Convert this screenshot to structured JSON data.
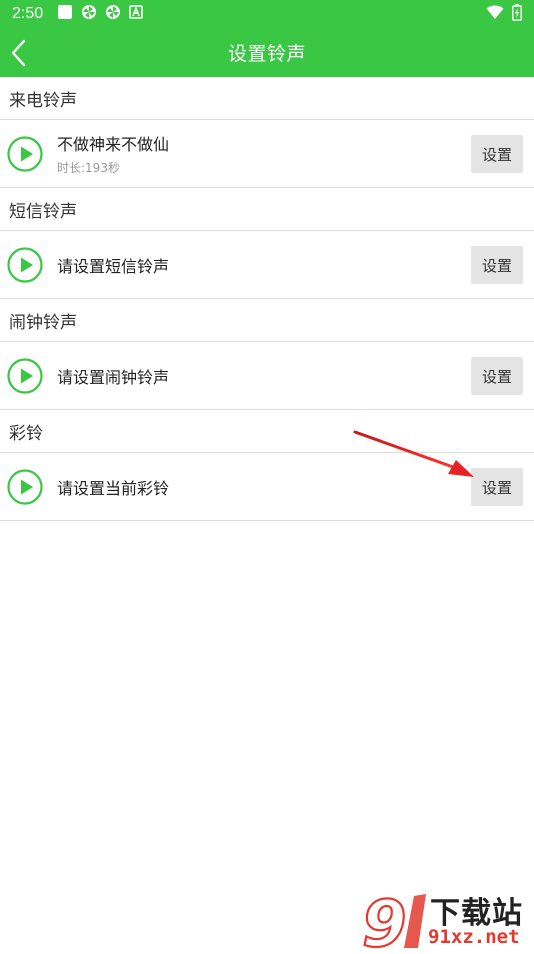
{
  "status_bar": {
    "time": "2:50",
    "icons": [
      "square-icon",
      "pinwheel-icon",
      "pinwheel-icon",
      "a-box-icon"
    ],
    "right_icons": [
      "wifi-icon",
      "battery-icon"
    ]
  },
  "app_bar": {
    "title": "设置铃声",
    "back_icon": "chevron-left-icon"
  },
  "colors": {
    "primary": "#39c744",
    "divider": "#dddddd",
    "button_bg": "#e4e4e4",
    "annotation_arrow": "#e02020"
  },
  "sections": [
    {
      "header": "来电铃声",
      "title": "不做神来不做仙",
      "subtitle": "时长:193秒",
      "button": "设置"
    },
    {
      "header": "短信铃声",
      "title": "请设置短信铃声",
      "subtitle": "",
      "button": "设置"
    },
    {
      "header": "闹钟铃声",
      "title": "请设置闹钟铃声",
      "subtitle": "",
      "button": "设置"
    },
    {
      "header": "彩铃",
      "title": "请设置当前彩铃",
      "subtitle": "",
      "button": "设置"
    }
  ],
  "watermark": {
    "logo_text": "下载站",
    "domain": "91xz.net"
  }
}
